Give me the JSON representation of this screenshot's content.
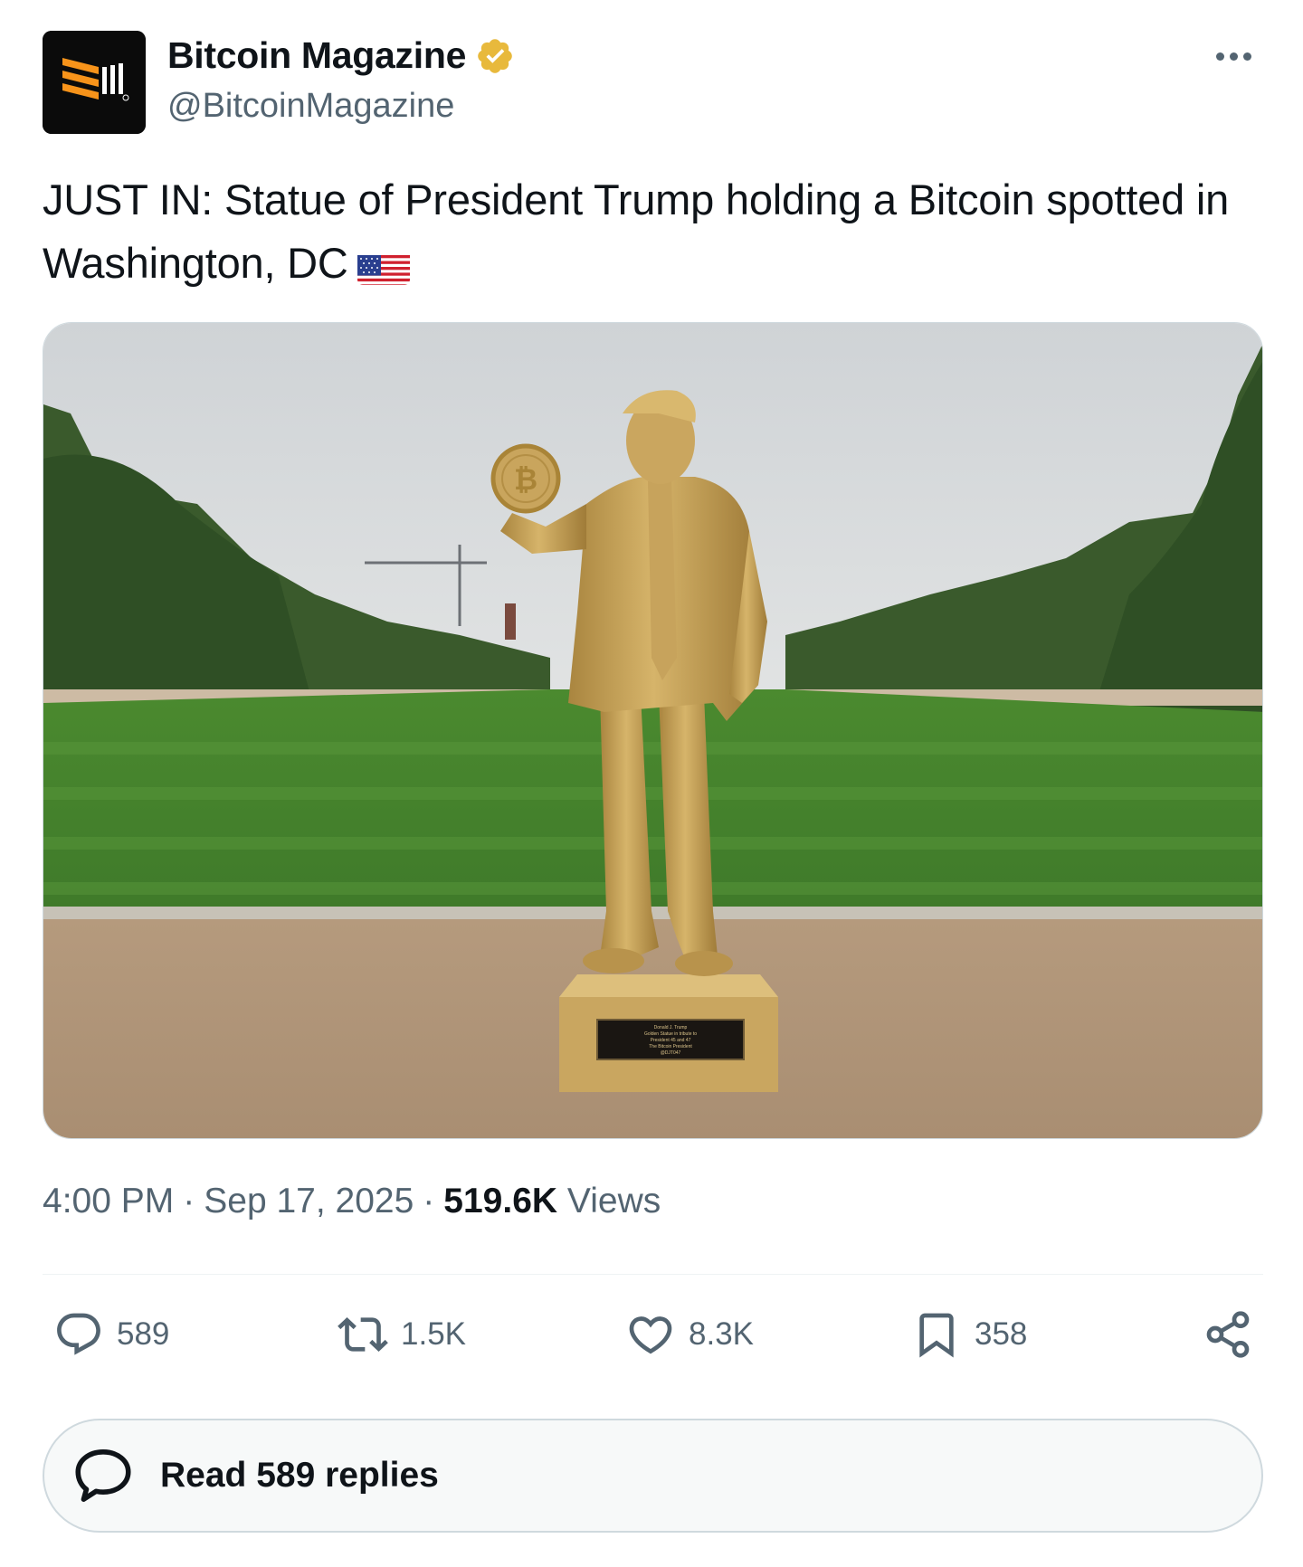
{
  "account": {
    "display_name": "Bitcoin Magazine",
    "handle": "@BitcoinMagazine",
    "verified": true,
    "verified_badge_color": "#e8b93c"
  },
  "tweet": {
    "text": "JUST IN: Statue of President Trump holding a Bitcoin spotted in Washington, DC",
    "flag_emoji": "us-flag-icon",
    "time": "4:00 PM",
    "date": "Sep 17, 2025",
    "views_count": "519.6K",
    "views_label": "Views"
  },
  "media": {
    "plaque_lines": [
      "Donald J. Trump",
      "Golden Statue in tribute to",
      "President 45 and 47",
      "The Bitcoin President",
      "@DJT047"
    ]
  },
  "actions": {
    "replies": "589",
    "reposts": "1.5K",
    "likes": "8.3K",
    "bookmarks": "358"
  },
  "read_replies": {
    "label": "Read 589 replies"
  },
  "colors": {
    "text_primary": "#0f1419",
    "text_secondary": "#536471",
    "border": "#cfd9de",
    "brand_orange": "#f7931a"
  }
}
